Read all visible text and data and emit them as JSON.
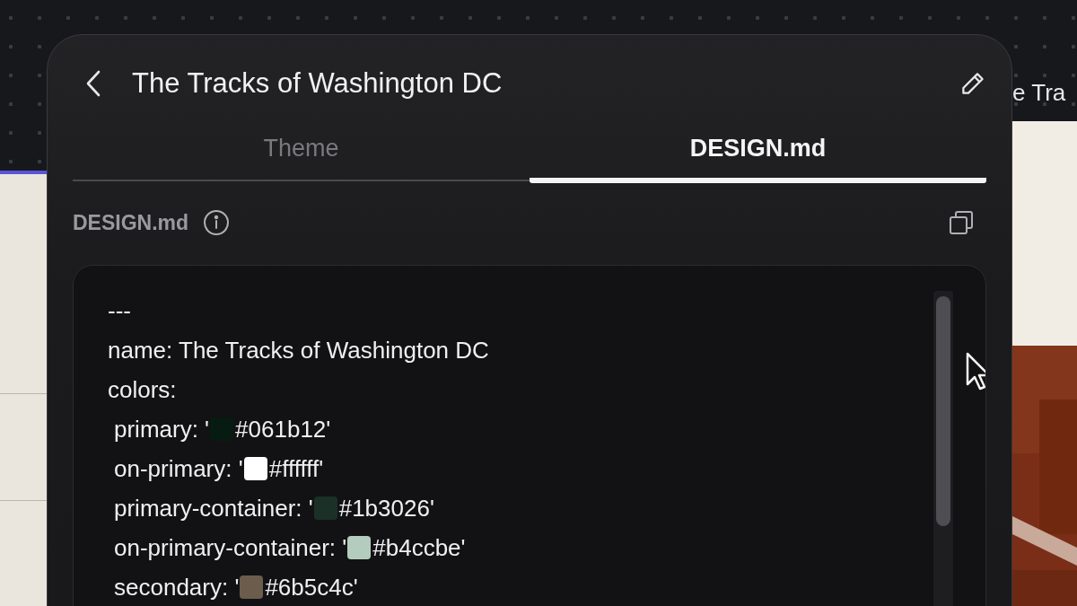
{
  "background": {
    "partial_title": "e Tra"
  },
  "panel": {
    "title": "The Tracks of Washington DC",
    "tabs": [
      {
        "label": "Theme",
        "selected": false
      },
      {
        "label": "DESIGN.md",
        "selected": true
      }
    ],
    "section": {
      "label": "DESIGN.md"
    },
    "code": {
      "lines": [
        {
          "kind": "text",
          "text": "---"
        },
        {
          "kind": "text",
          "text": "name: The Tracks of Washington DC"
        },
        {
          "kind": "text",
          "text": "colors:"
        },
        {
          "kind": "color",
          "key": "primary: '",
          "color": "#061b12",
          "value": "#061b12'"
        },
        {
          "kind": "color",
          "key": "on-primary: '",
          "color": "#ffffff",
          "value": "#ffffff'"
        },
        {
          "kind": "color",
          "key": "primary-container: '",
          "color": "#1b3026",
          "value": "#1b3026'"
        },
        {
          "kind": "color",
          "key": "on-primary-container: '",
          "color": "#b4ccbe",
          "value": "#b4ccbe'"
        },
        {
          "kind": "color",
          "key": "secondary: '",
          "color": "#6b5c4c",
          "value": "#6b5c4c'"
        }
      ]
    }
  }
}
